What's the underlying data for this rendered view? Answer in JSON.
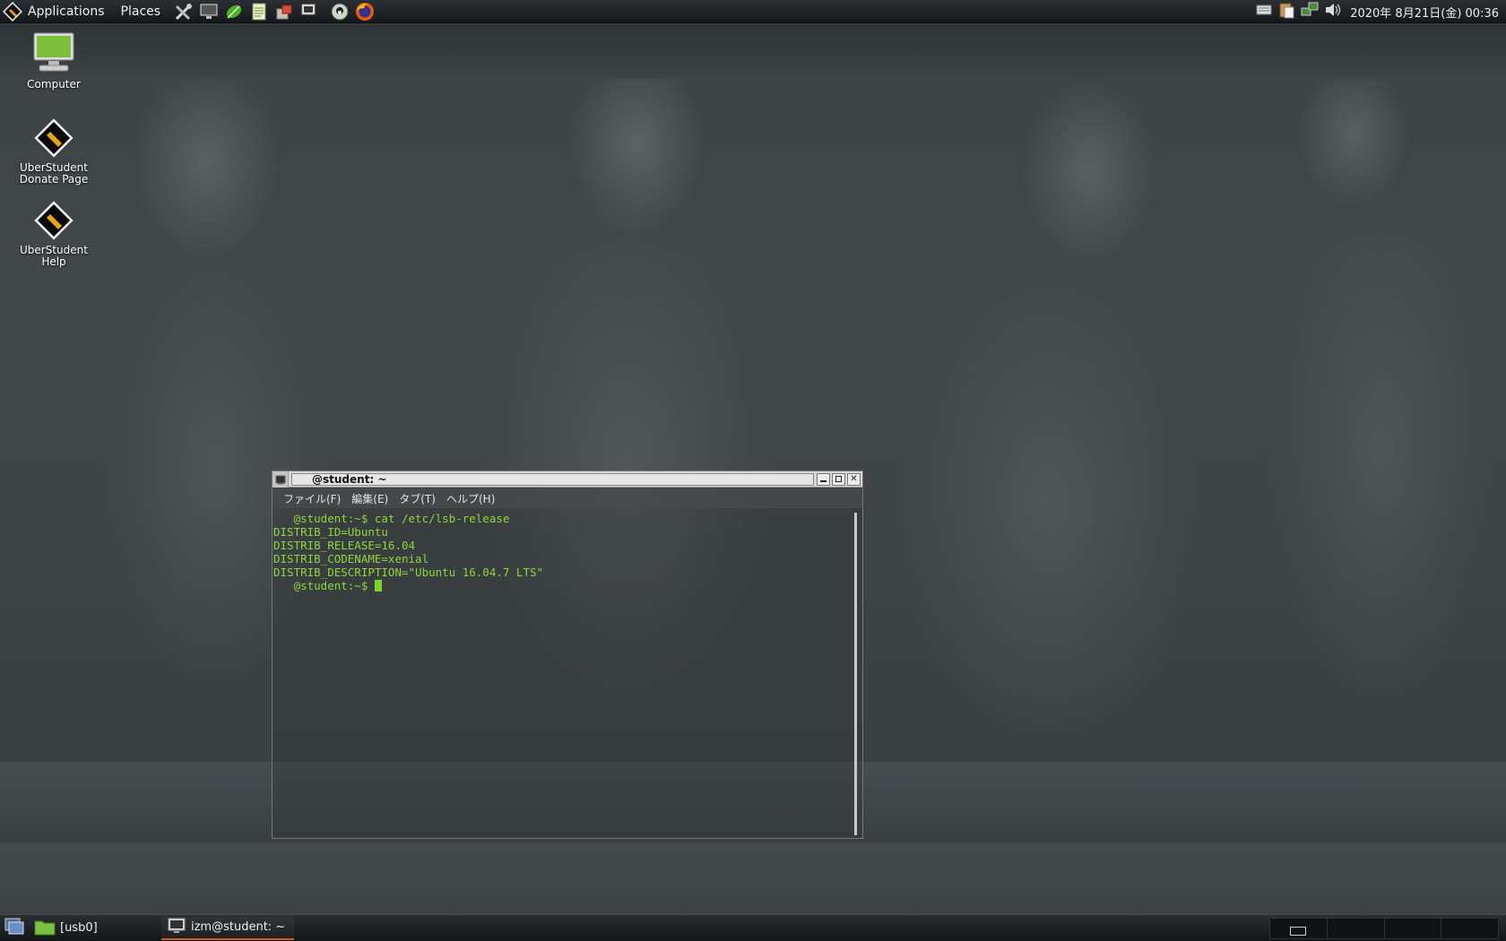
{
  "top_panel": {
    "applications_label": "Applications",
    "places_label": "Places",
    "clock": "2020年  8月21日(金)  00:36"
  },
  "desktop": {
    "icons": [
      {
        "line1": "Computer",
        "line2": ""
      },
      {
        "line1": "UberStudent",
        "line2": "Donate Page"
      },
      {
        "line1": "UberStudent",
        "line2": "Help"
      }
    ]
  },
  "terminal": {
    "title": "@student: ~",
    "menu": [
      "ファイル(F)",
      "編集(E)",
      "タブ(T)",
      "ヘルプ(H)"
    ],
    "lines": [
      "   @student:~$ cat /etc/lsb-release",
      "DISTRIB_ID=Ubuntu",
      "DISTRIB_RELEASE=16.04",
      "DISTRIB_CODENAME=xenial",
      "DISTRIB_DESCRIPTION=\"Ubuntu 16.04.7 LTS\"",
      "   @student:~$ "
    ]
  },
  "taskbar": {
    "tasks": [
      {
        "label": "[usb0]"
      },
      {
        "label": "izm@student: ~"
      }
    ]
  },
  "colors": {
    "terminal_text": "#8fd63a",
    "active_task_accent": "#d55a1e",
    "panel_bg": "#1c1f22"
  }
}
